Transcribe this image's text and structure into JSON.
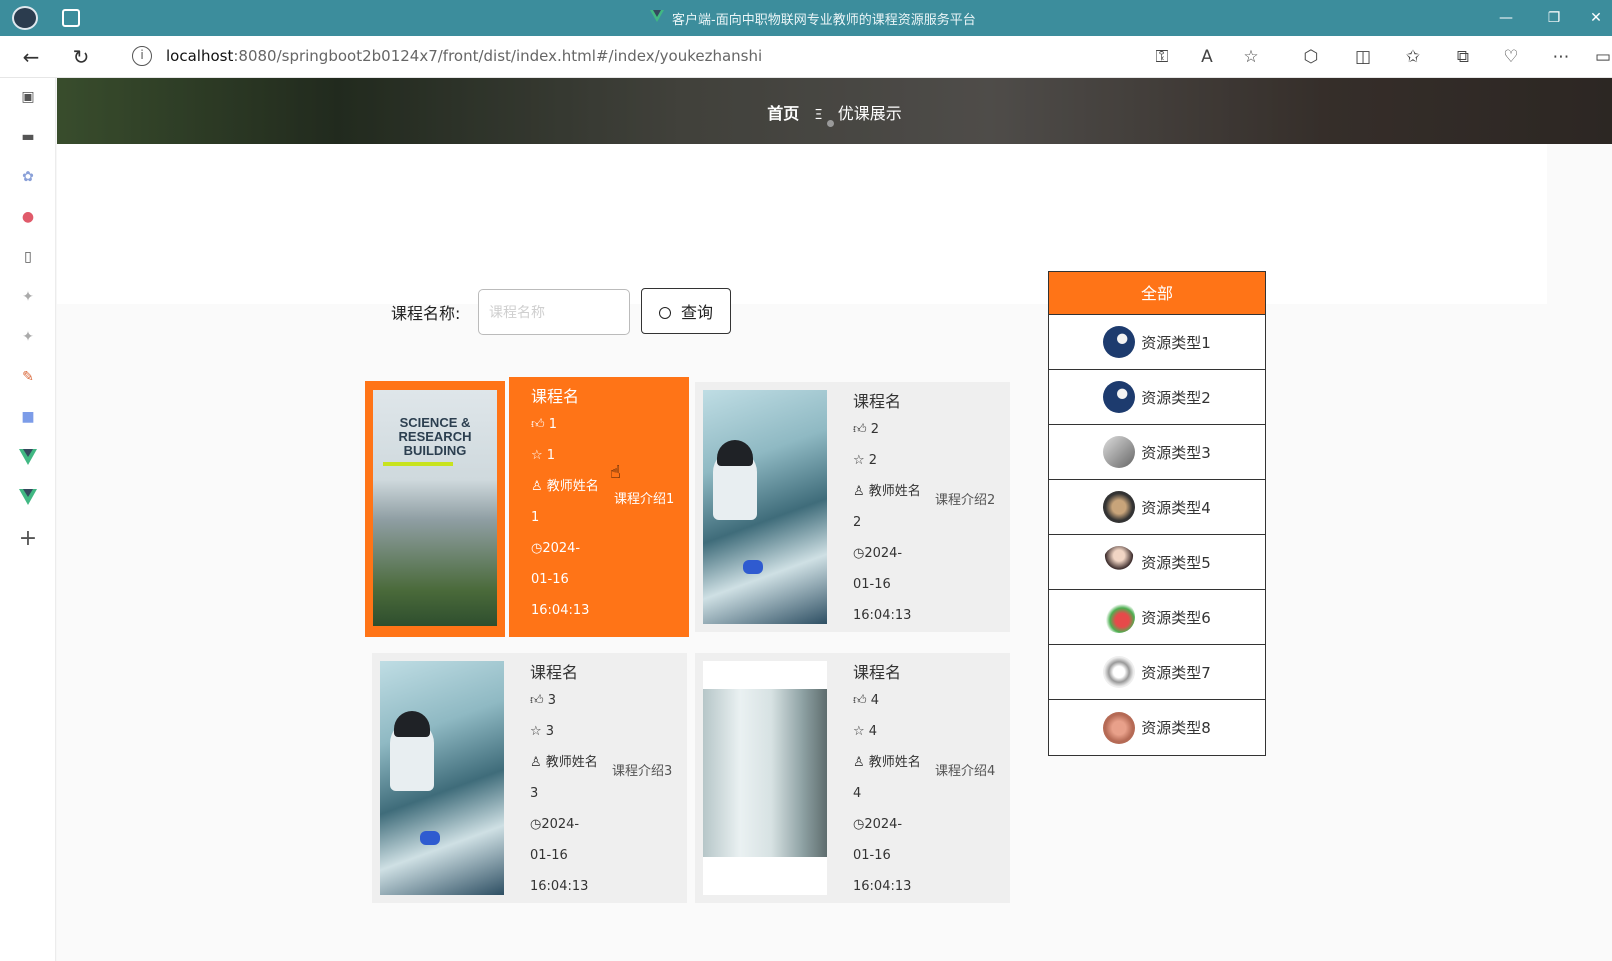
{
  "browser": {
    "window_title": "客户端-面向中职物联网专业教师的课程资源服务平台",
    "url_host": "localhost",
    "url_rest": ":8080/springboot2b0124x7/front/dist/index.html#/index/youkezhanshi"
  },
  "breadcrumb": {
    "home": "首页",
    "separator": "Ξ",
    "current": "优课展示"
  },
  "search": {
    "label": "课程名称:",
    "placeholder": "课程名称",
    "button_label": "查询"
  },
  "courses": [
    {
      "name": "课程名",
      "likes": "1",
      "favorites": "1",
      "teacher": "教师姓名1",
      "time": "2024-01-16 16:04:13",
      "intro": "课程介绍1",
      "image": "science-building"
    },
    {
      "name": "课程名",
      "likes": "2",
      "favorites": "2",
      "teacher": "教师姓名2",
      "time": "2024-01-16 16:04:13",
      "intro": "课程介绍2",
      "image": "lab-researcher"
    },
    {
      "name": "课程名",
      "likes": "3",
      "favorites": "3",
      "teacher": "教师姓名3",
      "time": "2024-01-16 16:04:13",
      "intro": "课程介绍3",
      "image": "lab-researcher"
    },
    {
      "name": "课程名",
      "likes": "4",
      "favorites": "4",
      "teacher": "教师姓名4",
      "time": "2024-01-16 16:04:13",
      "intro": "课程介绍4",
      "image": "lab-room"
    }
  ],
  "categories": {
    "all": "全部",
    "items": [
      "资源类型1",
      "资源类型2",
      "资源类型3",
      "资源类型4",
      "资源类型5",
      "资源类型6",
      "资源类型7",
      "资源类型8"
    ]
  },
  "colors": {
    "accent": "#ff7417",
    "titlebar": "#3c8d9c"
  }
}
